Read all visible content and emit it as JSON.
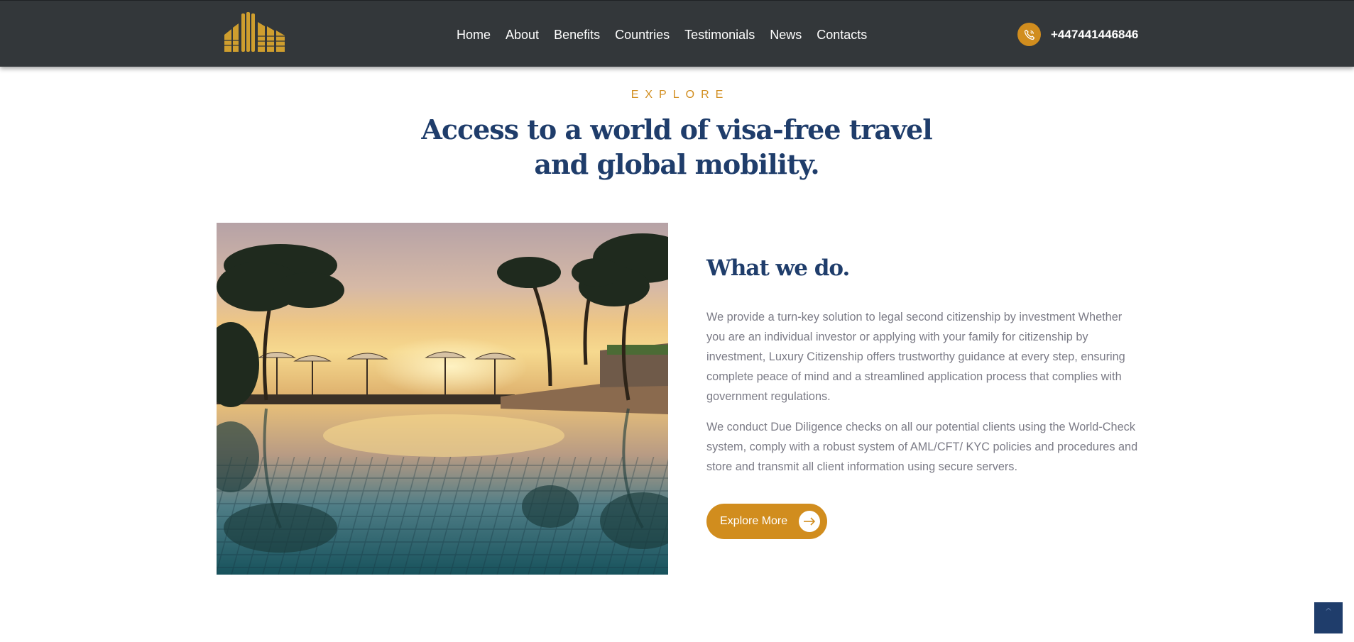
{
  "header": {
    "logo_icon": "building-logo-icon",
    "nav": [
      {
        "label": "Home"
      },
      {
        "label": "About"
      },
      {
        "label": "Benefits"
      },
      {
        "label": "Countries"
      },
      {
        "label": "Testimonials"
      },
      {
        "label": "News"
      },
      {
        "label": "Contacts"
      }
    ],
    "phone_icon": "phone-icon",
    "phone": "+447441446846"
  },
  "intro": {
    "eyebrow": "EXPLORE",
    "headline_line1": "Access to a world of visa-free travel",
    "headline_line2": "and global mobility."
  },
  "about": {
    "image": "resort-pool-sunset-photo",
    "title": "What we do.",
    "paragraph1": "We provide a turn-key solution to legal second citizenship by investment Whether you are an individual investor or applying with your family for citizenship by investment, Luxury Citizenship offers trustworthy guidance at every step, ensuring complete peace of mind and a streamlined application process that complies with government regulations.",
    "paragraph2": "We conduct Due Diligence checks on all our potential clients using the World-Check system, comply with a robust system of AML/CFT/ KYC policies and procedures and store and transmit all client information using secure servers.",
    "button_label": "Explore More",
    "button_icon": "arrow-right-icon"
  },
  "back_to_top": {
    "icon": "chevron-up-icon",
    "glyph": "^"
  },
  "colors": {
    "header_bg": "#33373a",
    "accent": "#d18d1e",
    "navy": "#1f3d6b",
    "body_text": "#7b7b86"
  }
}
